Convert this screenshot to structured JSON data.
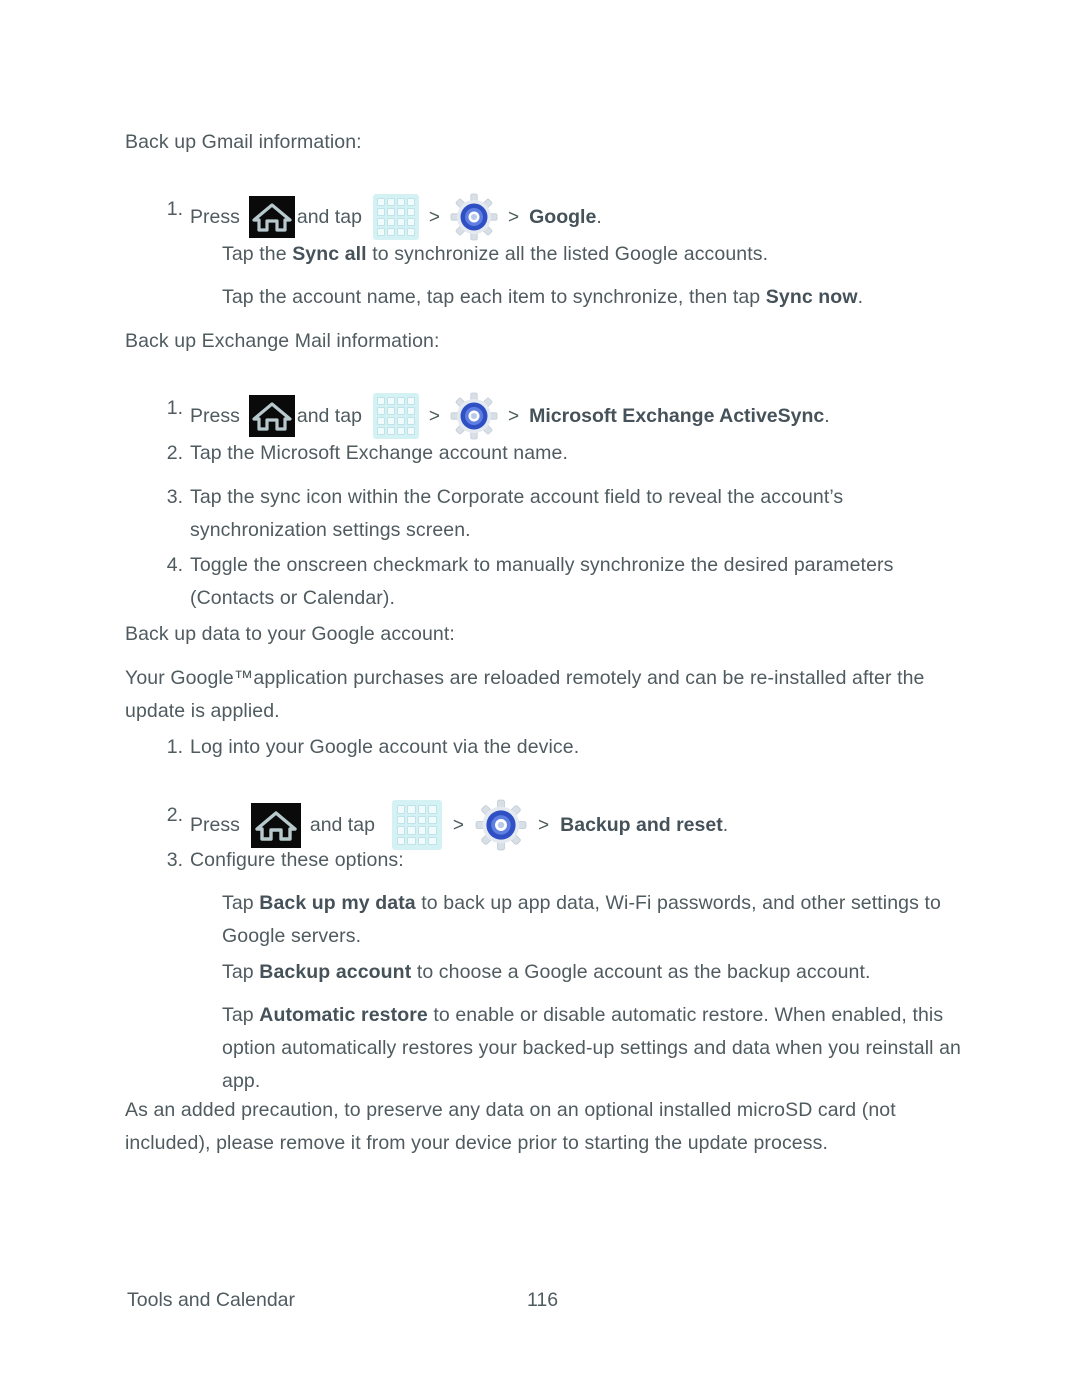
{
  "document": {
    "type": "user-guide-page",
    "page_number": "116",
    "footer_section": "Tools and Calendar",
    "text_color": "#4f5b5f"
  },
  "icons": {
    "home": "home-button-icon",
    "apps": "apps-grid-icon",
    "settings": "settings-gear-icon",
    "separator": ">"
  },
  "sections": [
    {
      "heading": "Back up Gmail information:",
      "steps": [
        {
          "number": "1.",
          "press_label": "Press",
          "and_tap_label": "and tap",
          "target": "Google",
          "trailing": "."
        }
      ],
      "notes": [
        {
          "prefix": "Tap the ",
          "bold": "Sync all",
          "suffix": " to synchronize all the listed Google accounts."
        },
        {
          "prefix": "Tap the account name, tap each item to synchronize, then tap ",
          "bold": "Sync now",
          "suffix": "."
        }
      ]
    },
    {
      "heading": "Back up Exchange Mail information:",
      "steps": [
        {
          "number": "1.",
          "press_label": "Press",
          "and_tap_label": "and tap",
          "target": "Microsoft Exchange ActiveSync",
          "trailing": "."
        },
        {
          "number": "2.",
          "text": "Tap the Microsoft Exchange account name."
        },
        {
          "number": "3.",
          "text": "Tap the sync icon within the Corporate account field to reveal the account’s synchronization settings screen."
        },
        {
          "number": "4.",
          "text": "Toggle the onscreen checkmark to manually synchronize the desired parameters (Contacts or Calendar)."
        }
      ]
    },
    {
      "heading": "Back up data to your Google account:",
      "intro": "Your Google™application purchases are reloaded remotely and can be re-installed after the update is applied.",
      "steps": [
        {
          "number": "1.",
          "text": "Log into your Google account via the device."
        },
        {
          "number": "2.",
          "press_label": "Press",
          "and_tap_label": "and tap",
          "target": "Backup and reset",
          "trailing": "."
        },
        {
          "number": "3.",
          "text": "Configure these options:"
        }
      ],
      "options": [
        {
          "prefix": "Tap ",
          "bold": "Back up my data",
          "suffix": " to back up app data, Wi-Fi passwords, and other settings to Google servers."
        },
        {
          "prefix": "Tap ",
          "bold": "Backup account",
          "suffix": " to choose a Google account as the backup account."
        },
        {
          "prefix": "Tap ",
          "bold": "Automatic restore",
          "suffix": " to enable or disable automatic restore. When enabled, this option automatically restores your backed-up settings and data when you reinstall an app."
        }
      ]
    }
  ],
  "closing_note": "As an added precaution, to preserve any data on an optional installed microSD card (not included), please remove it from your device prior to starting the update process."
}
